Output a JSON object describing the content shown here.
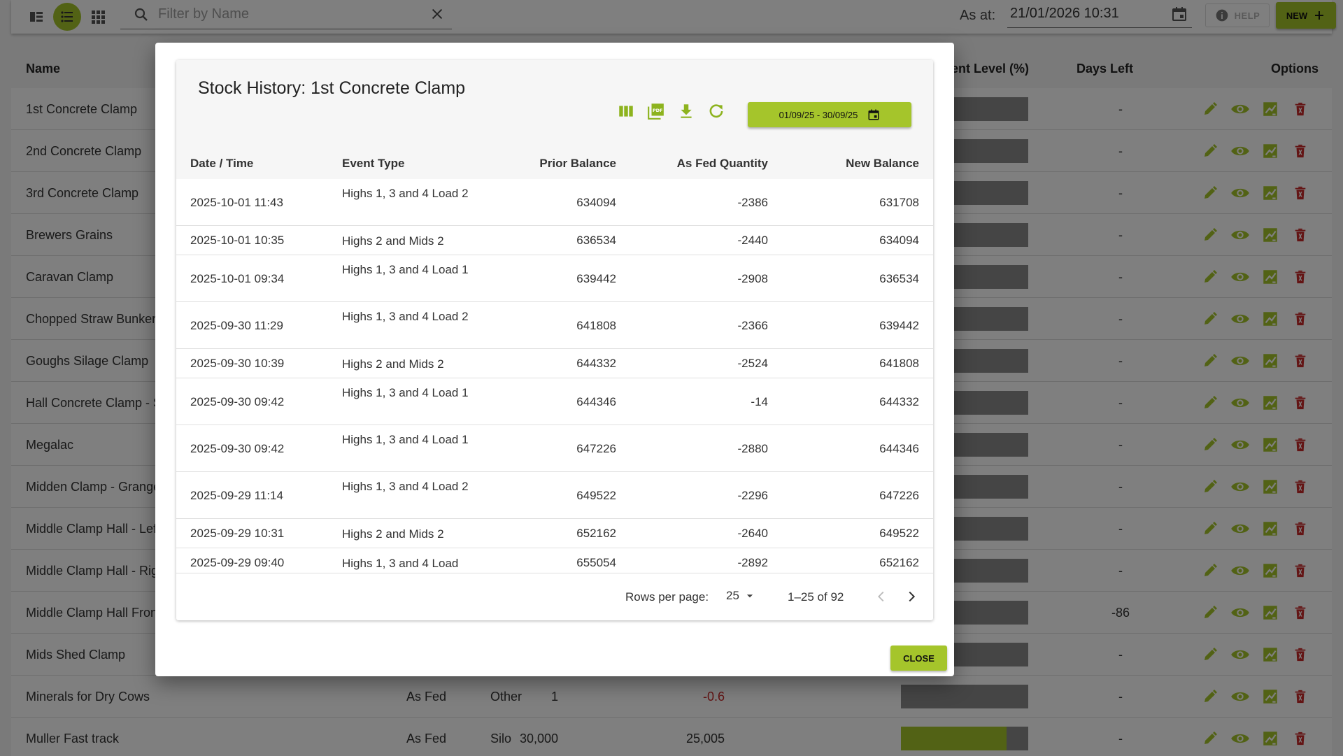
{
  "toolbar": {
    "filter_placeholder": "Filter by Name",
    "as_at_label": "As at:",
    "as_at_value": "21/01/2026 10:31",
    "help_label": "HELP",
    "new_label": "NEW"
  },
  "table": {
    "headers": {
      "name": "Name",
      "current_level": "ent Level (%)",
      "days_left": "Days Left",
      "options": "Options"
    },
    "rows": [
      {
        "name": "1st Concrete Clamp",
        "mode": "",
        "type": "",
        "capacity": "",
        "current": "",
        "level": 0,
        "days": "-"
      },
      {
        "name": "2nd Concrete Clamp",
        "mode": "",
        "type": "",
        "capacity": "",
        "current": "",
        "level": 0,
        "days": "-"
      },
      {
        "name": "3rd Concrete Clamp",
        "mode": "",
        "type": "",
        "capacity": "",
        "current": "",
        "level": 0,
        "days": "-"
      },
      {
        "name": "Brewers Grains",
        "mode": "",
        "type": "",
        "capacity": "",
        "current": "",
        "level": 0,
        "days": "-"
      },
      {
        "name": "Caravan Clamp",
        "mode": "",
        "type": "",
        "capacity": "",
        "current": "",
        "level": 0,
        "days": "-"
      },
      {
        "name": "Chopped Straw Bunker",
        "mode": "",
        "type": "",
        "capacity": "",
        "current": "",
        "level": 0.25,
        "days": "-"
      },
      {
        "name": "Goughs Silage Clamp",
        "mode": "",
        "type": "",
        "capacity": "",
        "current": "",
        "level": 0,
        "days": "-"
      },
      {
        "name": "Hall Concrete Clamp - S",
        "mode": "",
        "type": "",
        "capacity": "",
        "current": "",
        "level": 0,
        "days": "-"
      },
      {
        "name": "Megalac",
        "mode": "",
        "type": "",
        "capacity": "",
        "current": "",
        "level": 0,
        "days": "-"
      },
      {
        "name": "Midden Clamp - Grange",
        "mode": "",
        "type": "",
        "capacity": "",
        "current": "",
        "level": 0,
        "days": "-"
      },
      {
        "name": "Middle Clamp Hall - Left",
        "mode": "",
        "type": "",
        "capacity": "",
        "current": "",
        "level": 0,
        "days": "-"
      },
      {
        "name": "Middle Clamp Hall - Rig",
        "mode": "",
        "type": "",
        "capacity": "",
        "current": "",
        "level": 0,
        "days": "-"
      },
      {
        "name": "Middle Clamp Hall Fron",
        "mode": "",
        "type": "",
        "capacity": "",
        "current": "",
        "level": 0,
        "days": "-86"
      },
      {
        "name": "Mids Shed Clamp",
        "mode": "",
        "type": "",
        "capacity": "",
        "current": "",
        "level": 0,
        "days": "-"
      },
      {
        "name": "Minerals for Dry Cows",
        "mode": "As Fed",
        "type": "Other",
        "capacity": "1",
        "current": "-0.6",
        "level": 0,
        "days": "-"
      },
      {
        "name": "Muller Fast track",
        "mode": "As Fed",
        "type": "Silo",
        "capacity": "30,000",
        "current": "25,005",
        "level": 0.83,
        "days": "-"
      }
    ]
  },
  "dialog": {
    "title": "Stock History: 1st Concrete Clamp",
    "date_range": "01/09/25 - 30/09/25",
    "columns": [
      "Date / Time",
      "Event Type",
      "Prior Balance",
      "As Fed Quantity",
      "New Balance"
    ],
    "history": [
      {
        "date": "2025-10-01 11:43",
        "event": "Highs 1, 3 and 4 Load 2",
        "prior": "634094",
        "qty": "-2386",
        "new": "631708"
      },
      {
        "date": "2025-10-01 10:35",
        "event": "Highs 2 and Mids 2",
        "prior": "636534",
        "qty": "-2440",
        "new": "634094"
      },
      {
        "date": "2025-10-01 09:34",
        "event": "Highs 1, 3 and 4 Load 1",
        "prior": "639442",
        "qty": "-2908",
        "new": "636534"
      },
      {
        "date": "2025-09-30 11:29",
        "event": "Highs 1, 3 and 4 Load 2",
        "prior": "641808",
        "qty": "-2366",
        "new": "639442"
      },
      {
        "date": "2025-09-30 10:39",
        "event": "Highs 2 and Mids 2",
        "prior": "644332",
        "qty": "-2524",
        "new": "641808"
      },
      {
        "date": "2025-09-30 09:42",
        "event": "Highs 1, 3 and 4 Load 1",
        "prior": "644346",
        "qty": "-14",
        "new": "644332"
      },
      {
        "date": "2025-09-30 09:42",
        "event": "Highs 1, 3 and 4 Load 1",
        "prior": "647226",
        "qty": "-2880",
        "new": "644346"
      },
      {
        "date": "2025-09-29 11:14",
        "event": "Highs 1, 3 and 4 Load 2",
        "prior": "649522",
        "qty": "-2296",
        "new": "647226"
      },
      {
        "date": "2025-09-29 10:31",
        "event": "Highs 2 and Mids 2",
        "prior": "652162",
        "qty": "-2640",
        "new": "649522"
      },
      {
        "date": "2025-09-29 09:40",
        "event": "Highs 1, 3 and 4 Load",
        "prior": "655054",
        "qty": "-2892",
        "new": "652162"
      }
    ],
    "rows_per_page_label": "Rows per page:",
    "rows_per_page_value": "25",
    "range_text": "1–25 of 92",
    "close_label": "CLOSE"
  },
  "colors": {
    "accent": "#a5c52b",
    "danger": "#c62828",
    "negative": "#c62828",
    "bar": "#8a8a8a"
  }
}
